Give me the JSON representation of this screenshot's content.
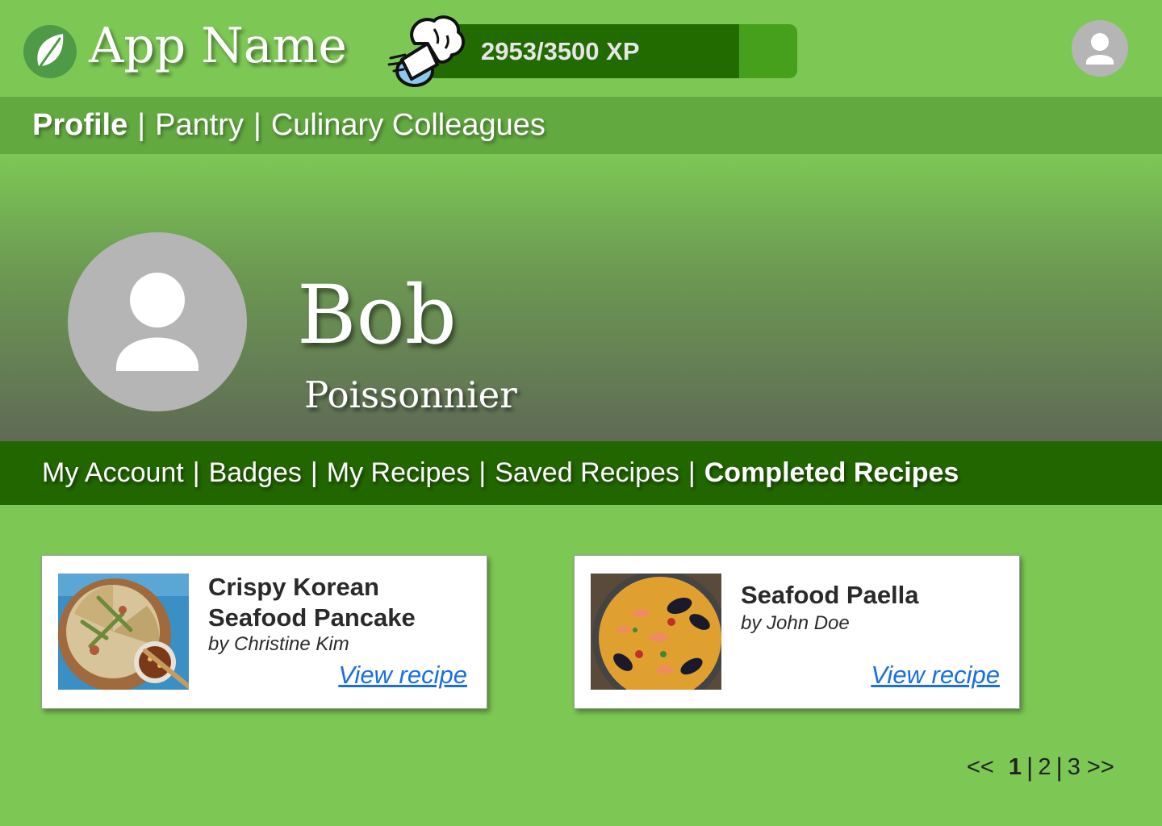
{
  "header": {
    "app_name": "App Name",
    "xp": {
      "current": 2953,
      "max": 3500,
      "label": "2953/3500 XP"
    },
    "accent_color": "#7dc855"
  },
  "main_nav": {
    "items": [
      {
        "label": "Profile",
        "active": true
      },
      {
        "label": "Pantry",
        "active": false
      },
      {
        "label": "Culinary Colleagues",
        "active": false
      }
    ],
    "separator": "|"
  },
  "profile": {
    "name": "Bob",
    "title": "Poissonnier"
  },
  "sub_nav": {
    "items": [
      {
        "label": "My Account",
        "active": false
      },
      {
        "label": "Badges",
        "active": false
      },
      {
        "label": "My Recipes",
        "active": false
      },
      {
        "label": "Saved Recipes",
        "active": false
      },
      {
        "label": "Completed Recipes",
        "active": true
      }
    ],
    "separator": "|",
    "background_color": "#226600"
  },
  "recipes": [
    {
      "title": "Crispy Korean Seafood Pancake",
      "author": "by Christine Kim",
      "link_label": "View recipe"
    },
    {
      "title": "Seafood Paella",
      "author": "by John Doe",
      "link_label": "View recipe"
    }
  ],
  "pagination": {
    "prev": "<<",
    "next": ">>",
    "pages": [
      "1",
      "2",
      "3"
    ],
    "current": "1",
    "separator": "|"
  },
  "icons": {
    "logo": "leaf-logo-icon",
    "xp_badge": "chef-hat-icon",
    "account": "user-avatar-icon"
  }
}
